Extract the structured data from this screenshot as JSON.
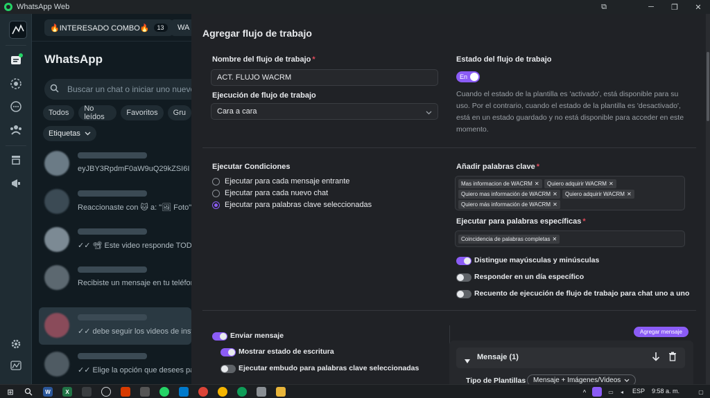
{
  "window": {
    "title": "WhatsApp Web",
    "controls": [
      "⧉",
      "─",
      "❐",
      "✕"
    ]
  },
  "top_tabs": [
    {
      "label": "🔥INTERESADO COMBO🔥",
      "count": "13"
    },
    {
      "label": "WA"
    }
  ],
  "chatlist": {
    "title": "WhatsApp",
    "search_placeholder": "Buscar un chat o iniciar uno nuevo",
    "filters": [
      "Todos",
      "No leídos",
      "Favoritos",
      "Gru"
    ],
    "labels_filter": "Etiquetas",
    "chats": [
      {
        "snippet": "eyJBY3RpdmF0aW9uQ29kZSI6I"
      },
      {
        "snippet": "Reaccionaste con 🐱 a: \"🖼 Foto\""
      },
      {
        "snippet": "✓✓ 📽 Este video responde TODO"
      },
      {
        "snippet": "Recibiste un mensaje en tu teléfono"
      },
      {
        "snippet": "✓✓ debe seguir los videos de instal"
      },
      {
        "snippet": "✓✓ Elige la opción que desees para"
      }
    ]
  },
  "workflow": {
    "title": "Agregar flujo de trabajo",
    "name_label": "Nombre del flujo de trabajo",
    "name_value": "ACT. FLUJO WACRM",
    "execution_label": "Ejecución de flujo de trabajo",
    "execution_value": "Cara a cara",
    "state_label": "Estado del flujo de trabajo",
    "state_toggle": "En",
    "state_desc": "Cuando el estado de la plantilla es 'activado', está disponible para su uso. Por el contrario, cuando el estado de la plantilla es 'desactivado', está en un estado guardado y no está disponible para acceder en este momento.",
    "conditions_label": "Ejecutar Condiciones",
    "conditions": [
      {
        "label": "Ejecutar para cada mensaje entrante",
        "selected": false
      },
      {
        "label": "Ejecutar para cada nuevo chat",
        "selected": false
      },
      {
        "label": "Ejecutar para palabras clave seleccionadas",
        "selected": true
      }
    ],
    "keywords_label": "Añadir palabras clave",
    "keywords": [
      "Mas informacion de WACRM",
      "Quiero adquirir WACRM",
      "Quiero mas información de WACRM",
      "Quiero adquirir WACRM",
      "Quiero más información de WACRM"
    ],
    "specific_label": "Ejecutar para palabras específicas",
    "specific": [
      "Coincidencia de palabras completas"
    ],
    "toggles": [
      {
        "label": "Distingue mayúsculas y minúsculas",
        "on": true
      },
      {
        "label": "Responder en un día específico",
        "on": false
      },
      {
        "label": "Recuento de ejecución de flujo de trabajo para chat uno a uno",
        "on": false
      }
    ],
    "send_toggles": [
      {
        "label": "Enviar mensaje",
        "on": true
      },
      {
        "label": "Mostrar estado de escritura",
        "on": true
      },
      {
        "label": "Ejecutar embudo para palabras clave seleccionadas",
        "on": false
      }
    ],
    "add_message_button": "Agregar mensaje",
    "message_panel": {
      "title": "Mensaje (1)",
      "template_type_label": "Tipo de Plantillas",
      "template_type_value": "Mensaje + Imágenes/Videos"
    }
  },
  "taskbar": {
    "language": "ESP",
    "time": "9:58 a. m."
  }
}
